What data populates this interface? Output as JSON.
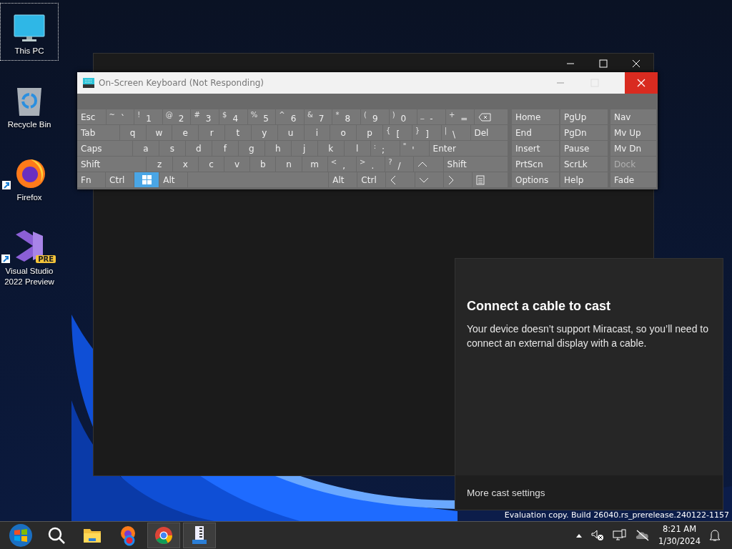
{
  "desktop_icons": [
    {
      "kind": "computer",
      "label": "This PC",
      "selected": true
    },
    {
      "kind": "recycle",
      "label": "Recycle Bin",
      "selected": false
    },
    {
      "kind": "firefox",
      "label": "Firefox",
      "selected": false,
      "shortcut": true
    },
    {
      "kind": "studio",
      "label": "Visual Studio 2022 Preview",
      "selected": false,
      "shortcut": true,
      "badge": "PRE"
    }
  ],
  "keyboard": {
    "title": "On-Screen Keyboard (Not Responding)",
    "rows": [
      {
        "keys": [
          {
            "kind": "label",
            "label": "Esc",
            "pressed": false
          },
          {
            "kind": "dual",
            "shift": "~",
            "label": "`",
            "pressed": false
          },
          {
            "kind": "dual",
            "shift": "!",
            "label": "1",
            "pressed": false
          },
          {
            "kind": "dual",
            "shift": "@",
            "label": "2",
            "pressed": false
          },
          {
            "kind": "dual",
            "shift": "#",
            "label": "3",
            "pressed": false
          },
          {
            "kind": "dual",
            "shift": "$",
            "label": "4",
            "pressed": false
          },
          {
            "kind": "dual",
            "shift": "%",
            "label": "5",
            "pressed": false
          },
          {
            "kind": "dual",
            "shift": "^",
            "label": "6",
            "pressed": false
          },
          {
            "kind": "dual",
            "shift": "&",
            "label": "7",
            "pressed": false
          },
          {
            "kind": "dual",
            "shift": "*",
            "label": "8",
            "pressed": false
          },
          {
            "kind": "dual",
            "shift": "(",
            "label": "9",
            "pressed": false
          },
          {
            "kind": "dual",
            "shift": ")",
            "label": "0",
            "pressed": false
          },
          {
            "kind": "dual",
            "shift": "_",
            "label": "-",
            "pressed": false
          },
          {
            "kind": "dual",
            "shift": "+",
            "label": "=",
            "pressed": false
          },
          {
            "kind": "backspace",
            "pressed": false
          }
        ]
      },
      {
        "keys": [
          {
            "kind": "label",
            "label": "Tab",
            "pressed": false
          },
          {
            "kind": "letter",
            "label": "q",
            "pressed": false
          },
          {
            "kind": "letter",
            "label": "w",
            "pressed": false
          },
          {
            "kind": "letter",
            "label": "e",
            "pressed": false
          },
          {
            "kind": "letter",
            "label": "r",
            "pressed": false
          },
          {
            "kind": "letter",
            "label": "t",
            "pressed": false
          },
          {
            "kind": "letter",
            "label": "y",
            "pressed": false
          },
          {
            "kind": "letter",
            "label": "u",
            "pressed": false
          },
          {
            "kind": "letter",
            "label": "i",
            "pressed": false
          },
          {
            "kind": "letter",
            "label": "o",
            "pressed": false
          },
          {
            "kind": "letter",
            "label": "p",
            "pressed": false
          },
          {
            "kind": "dual",
            "shift": "{",
            "label": "[",
            "pressed": false
          },
          {
            "kind": "dual",
            "shift": "}",
            "label": "]",
            "pressed": false
          },
          {
            "kind": "dual",
            "shift": "|",
            "label": "\\",
            "pressed": false
          },
          {
            "kind": "label",
            "label": "Del",
            "pressed": false
          }
        ]
      },
      {
        "keys": [
          {
            "kind": "label",
            "label": "Caps",
            "pressed": false
          },
          {
            "kind": "letter",
            "label": "a",
            "pressed": false
          },
          {
            "kind": "letter",
            "label": "s",
            "pressed": false
          },
          {
            "kind": "letter",
            "label": "d",
            "pressed": false
          },
          {
            "kind": "letter",
            "label": "f",
            "pressed": false
          },
          {
            "kind": "letter",
            "label": "g",
            "pressed": false
          },
          {
            "kind": "letter",
            "label": "h",
            "pressed": false
          },
          {
            "kind": "letter",
            "label": "j",
            "pressed": false
          },
          {
            "kind": "letter",
            "label": "k",
            "pressed": false
          },
          {
            "kind": "letter",
            "label": "l",
            "pressed": false
          },
          {
            "kind": "dual",
            "shift": ":",
            "label": ";",
            "pressed": false
          },
          {
            "kind": "dual",
            "shift": "\"",
            "label": "'",
            "pressed": false
          },
          {
            "kind": "label",
            "label": "Enter",
            "pressed": false
          }
        ]
      },
      {
        "keys": [
          {
            "kind": "label",
            "label": "Shift",
            "pressed": false
          },
          {
            "kind": "letter",
            "label": "z",
            "pressed": false
          },
          {
            "kind": "letter",
            "label": "x",
            "pressed": false
          },
          {
            "kind": "letter",
            "label": "c",
            "pressed": false
          },
          {
            "kind": "letter",
            "label": "v",
            "pressed": false
          },
          {
            "kind": "letter",
            "label": "b",
            "pressed": false
          },
          {
            "kind": "letter",
            "label": "n",
            "pressed": false
          },
          {
            "kind": "letter",
            "label": "m",
            "pressed": false
          },
          {
            "kind": "dual",
            "shift": "<",
            "label": ",",
            "pressed": false
          },
          {
            "kind": "dual",
            "shift": ">",
            "label": ".",
            "pressed": false
          },
          {
            "kind": "dual",
            "shift": "?",
            "label": "/",
            "pressed": false
          },
          {
            "kind": "up",
            "pressed": false
          },
          {
            "kind": "label",
            "label": "Shift",
            "pressed": false
          }
        ]
      },
      {
        "keys": [
          {
            "kind": "label",
            "label": "Fn",
            "pressed": false
          },
          {
            "kind": "label",
            "label": "Ctrl",
            "pressed": false
          },
          {
            "kind": "windows",
            "pressed": true
          },
          {
            "kind": "label",
            "label": "Alt",
            "pressed": false
          },
          {
            "kind": "space",
            "pressed": false
          },
          {
            "kind": "label",
            "label": "Alt",
            "pressed": false
          },
          {
            "kind": "label",
            "label": "Ctrl",
            "pressed": false
          },
          {
            "kind": "left",
            "pressed": false
          },
          {
            "kind": "down",
            "pressed": false
          },
          {
            "kind": "right",
            "pressed": false
          },
          {
            "kind": "menu",
            "pressed": false
          }
        ]
      }
    ],
    "nav_keys": [
      {
        "label": "Home",
        "disabled": false
      },
      {
        "label": "PgUp",
        "disabled": false
      },
      {
        "label": "Nav",
        "disabled": false
      },
      {
        "label": "End",
        "disabled": false
      },
      {
        "label": "PgDn",
        "disabled": false
      },
      {
        "label": "Mv Up",
        "disabled": false
      },
      {
        "label": "Insert",
        "disabled": false
      },
      {
        "label": "Pause",
        "disabled": false
      },
      {
        "label": "Mv Dn",
        "disabled": false
      },
      {
        "label": "PrtScn",
        "disabled": false
      },
      {
        "label": "ScrLk",
        "disabled": false
      },
      {
        "label": "Dock",
        "disabled": true
      },
      {
        "label": "Options",
        "disabled": false
      },
      {
        "label": "Help",
        "disabled": false
      },
      {
        "label": "Fade",
        "disabled": false
      }
    ]
  },
  "cast_panel": {
    "title": "Connect a cable to cast",
    "message": "Your device doesn’t support Miracast, so you’ll need to connect an external display with a cable.",
    "link": "More cast settings"
  },
  "desktop_watermark": "Evaluation copy. Build 26040.rs_prerelease.240122-1157",
  "taskbar": {
    "apps": [
      {
        "kind": "start",
        "active": false
      },
      {
        "kind": "search",
        "active": false
      },
      {
        "kind": "folder",
        "active": false
      },
      {
        "kind": "firefox",
        "active": false
      },
      {
        "kind": "chrome",
        "active": true
      },
      {
        "kind": "keyboard",
        "active": true
      }
    ],
    "time": "8:21 AM",
    "date": "1/30/2024"
  }
}
